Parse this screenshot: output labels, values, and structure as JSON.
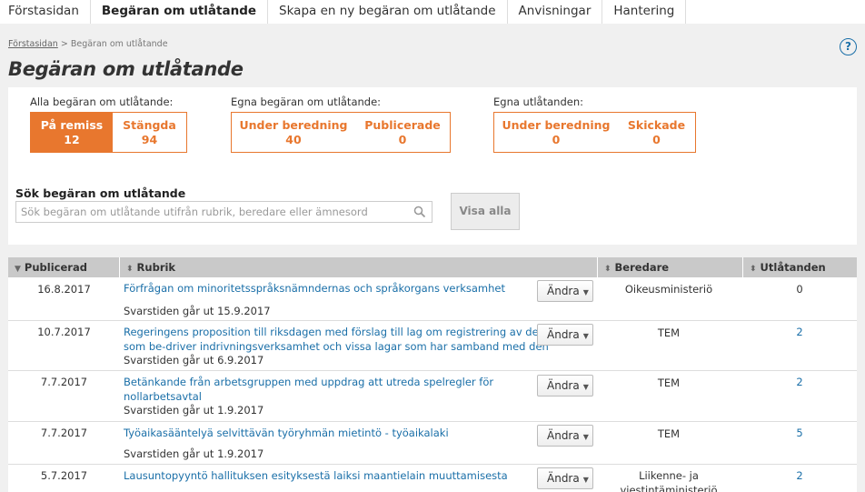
{
  "nav": {
    "tabs": [
      {
        "label": "Förstasidan"
      },
      {
        "label": "Begäran om utlåtande"
      },
      {
        "label": "Skapa en ny begäran om utlåtande"
      },
      {
        "label": "Anvisningar"
      },
      {
        "label": "Hantering"
      }
    ]
  },
  "breadcrumb": {
    "home": "Förstasidan",
    "sep": ">",
    "current": "Begäran om utlåtande"
  },
  "help": {
    "glyph": "?"
  },
  "page_title": "Begäran om utlåtande",
  "filters": {
    "all": {
      "label": "Alla begäran om utlåtande:",
      "boxes": [
        {
          "label": "På remiss",
          "count": "12"
        },
        {
          "label": "Stängda",
          "count": "94"
        }
      ]
    },
    "own_requests": {
      "label": "Egna begäran om utlåtande:",
      "boxes": [
        {
          "label": "Under beredning",
          "count": "40"
        },
        {
          "label": "Publicerade",
          "count": "0"
        }
      ]
    },
    "own_statements": {
      "label": "Egna utlåtanden:",
      "boxes": [
        {
          "label": "Under beredning",
          "count": "0"
        },
        {
          "label": "Skickade",
          "count": "0"
        }
      ]
    }
  },
  "search": {
    "label": "Sök begäran om utlåtande",
    "placeholder": "Sök begäran om utlåtande utifrån rubrik, beredare eller ämnesord",
    "show_all": "Visa alla"
  },
  "table": {
    "headers": {
      "published": "Publicerad",
      "title": "Rubrik",
      "preparer": "Beredare",
      "statements": "Utlåtanden"
    },
    "edit_label": "Ändra",
    "rows": [
      {
        "date": "16.8.2017",
        "title1": "Förfrågan om minoritetsspråksnämndernas och språkorgans verksamhet",
        "title2": "",
        "deadline": "Svarstiden går ut 15.9.2017",
        "preparer1": "Oikeusministeriö",
        "preparer2": "",
        "count": "0"
      },
      {
        "date": "10.7.2017",
        "title1": "Regeringens proposition till riksdagen med förslag till lag om registrering av den",
        "title2": "som be-driver indrivningsverksamhet och vissa lagar som har samband med den",
        "deadline": "Svarstiden går ut 6.9.2017",
        "preparer1": "TEM",
        "preparer2": "",
        "count": "2"
      },
      {
        "date": "7.7.2017",
        "title1": "Betänkande från arbetsgruppen med uppdrag att utreda spelregler för",
        "title2": "nollarbetsavtal",
        "deadline": "Svarstiden går ut 1.9.2017",
        "preparer1": "TEM",
        "preparer2": "",
        "count": "2"
      },
      {
        "date": "7.7.2017",
        "title1": "Työaikasääntelyä selvittävän työryhmän mietintö - työaikalaki",
        "title2": "",
        "deadline": "Svarstiden går ut 1.9.2017",
        "preparer1": "TEM",
        "preparer2": "",
        "count": "5"
      },
      {
        "date": "5.7.2017",
        "title1": "Lausuntopyyntö hallituksen esityksestä laiksi maantielain muuttamisesta",
        "title2": "",
        "deadline": "",
        "preparer1": "Liikenne- ja",
        "preparer2": "viestintäministeriö",
        "count": "2"
      }
    ]
  }
}
